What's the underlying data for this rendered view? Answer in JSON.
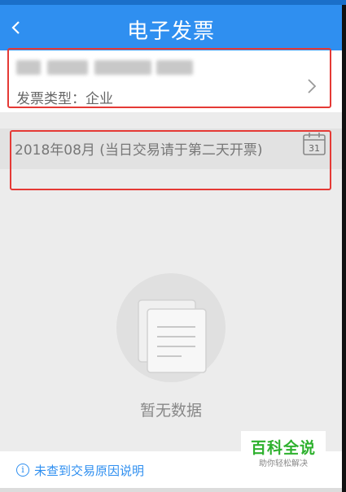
{
  "header": {
    "title": "电子发票"
  },
  "invoice_info": {
    "company_name": "",
    "invoice_type_label": "发票类型：企业"
  },
  "date_filter": {
    "text": "2018年08月 (当日交易请于第二天开票)",
    "calendar_day": "31"
  },
  "empty_state": {
    "text": "暂无数据"
  },
  "bottom_link": {
    "text": "未查到交易原因说明"
  },
  "watermark": {
    "title": "百科全说",
    "subtitle": "助你轻松解决"
  },
  "colors": {
    "primary": "#2f8ff0",
    "highlight": "#e53935",
    "watermark_green": "#2eb12e"
  }
}
